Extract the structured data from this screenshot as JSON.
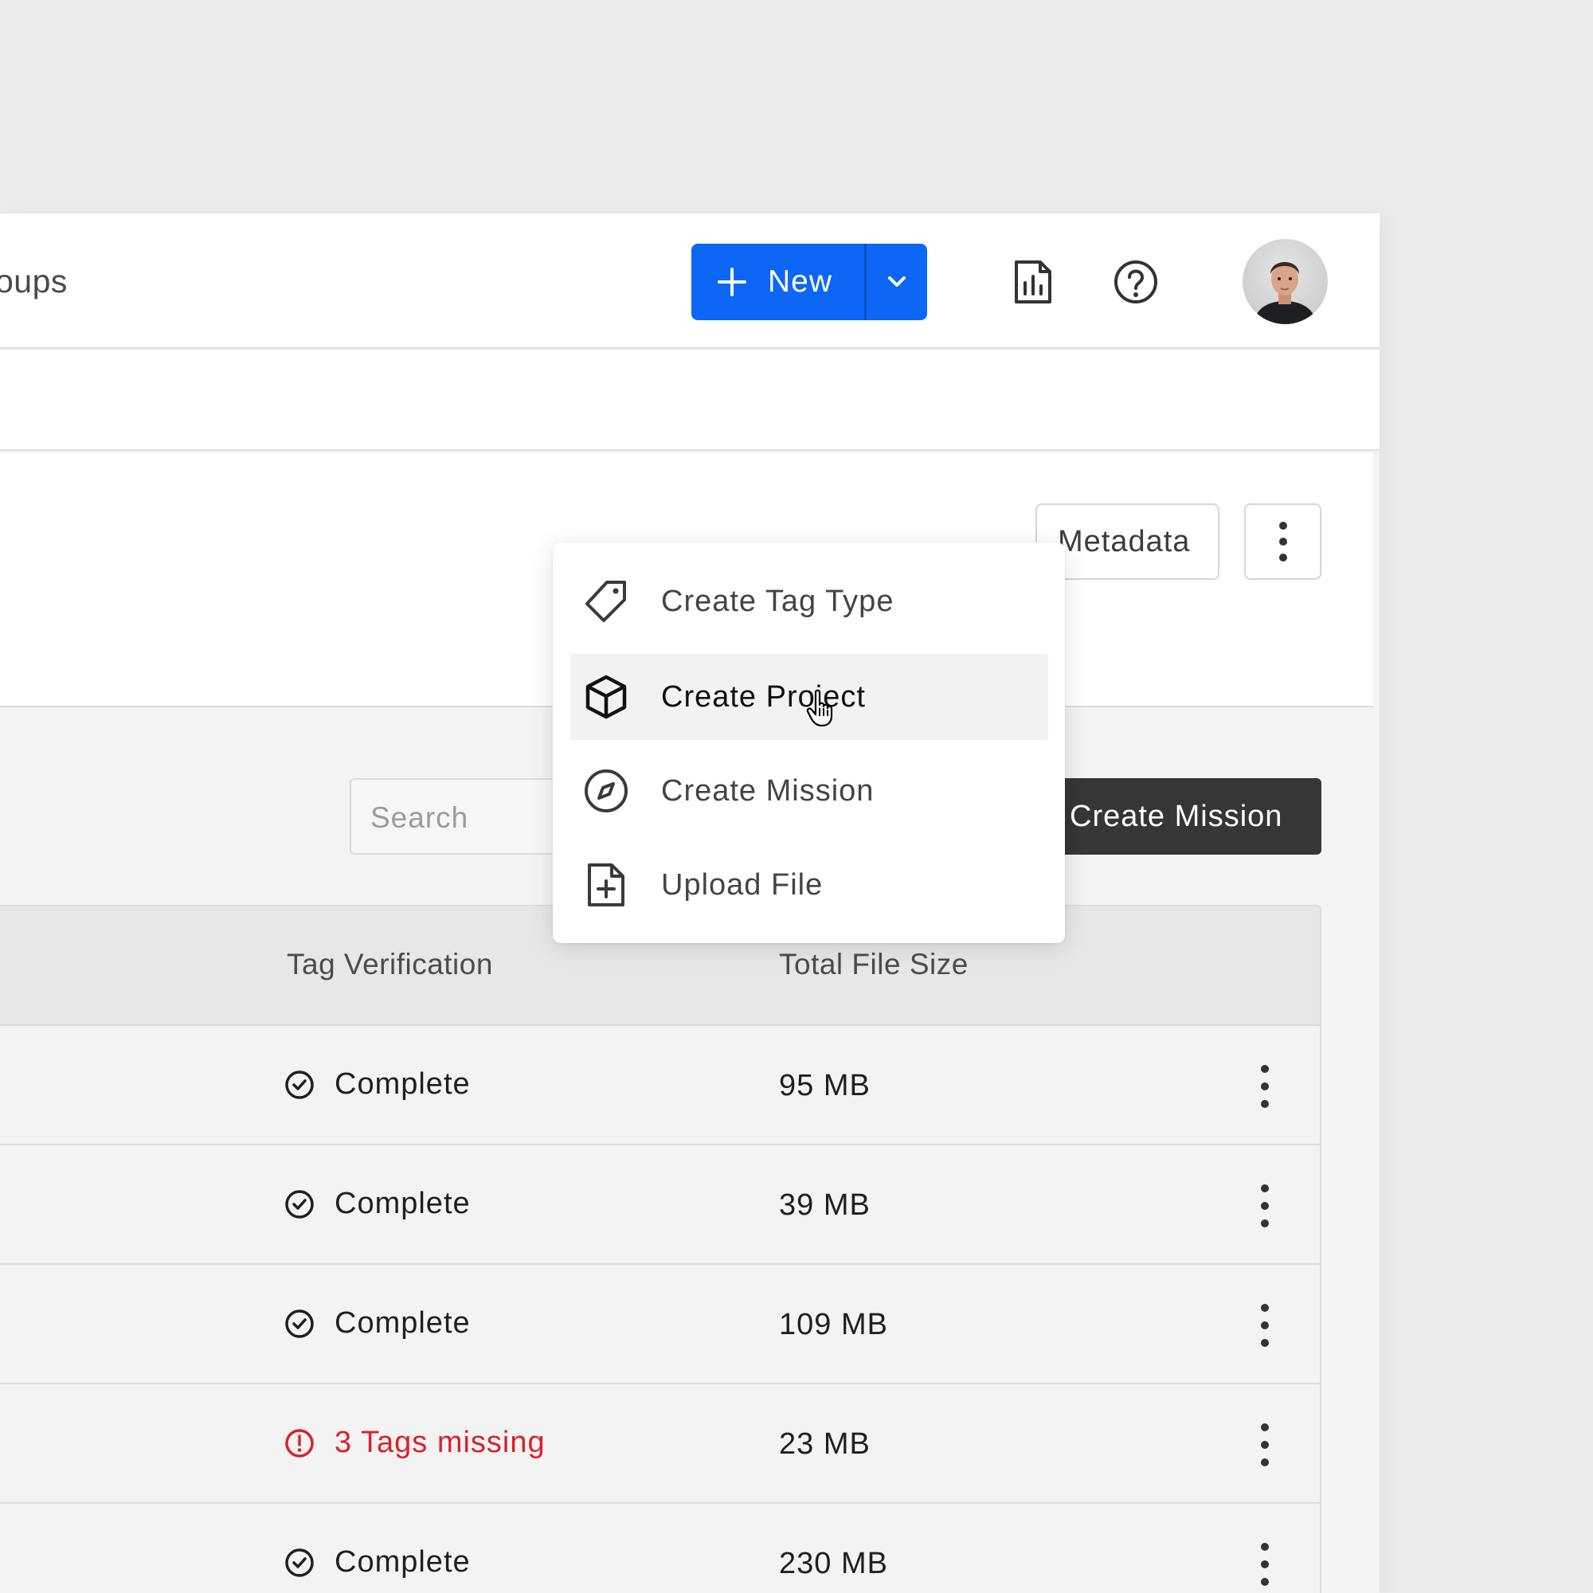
{
  "topbar": {
    "nav_partial_text": "oups",
    "new_button_label": "New",
    "icons": [
      "plus-icon",
      "chevron-down-icon",
      "report-chart-icon",
      "help-icon"
    ],
    "accent_color": "#0d66f6"
  },
  "header_panel": {
    "metadata_button_label": "Metadata"
  },
  "new_menu": {
    "items": [
      {
        "label": "Create Tag Type",
        "icon": "tag-icon"
      },
      {
        "label": "Create Project",
        "icon": "cube-icon",
        "highlighted": true
      },
      {
        "label": "Create Mission",
        "icon": "compass-icon"
      },
      {
        "label": "Upload File",
        "icon": "file-plus-icon"
      }
    ]
  },
  "toolbar": {
    "search_placeholder": "Search",
    "create_mission_label": "Create Mission"
  },
  "table": {
    "headers": {
      "tag_verification": "Tag Verification",
      "total_file_size": "Total File Size"
    },
    "rows": [
      {
        "status": "Complete",
        "status_type": "ok",
        "size": "95 MB"
      },
      {
        "status": "Complete",
        "status_type": "ok",
        "size": "39 MB"
      },
      {
        "status": "Complete",
        "status_type": "ok",
        "size": "109 MB"
      },
      {
        "status": "3 Tags missing",
        "status_type": "error",
        "size": "23 MB"
      },
      {
        "status": "Complete",
        "status_type": "ok",
        "size": "230 MB"
      }
    ],
    "error_color": "#d8232a"
  }
}
